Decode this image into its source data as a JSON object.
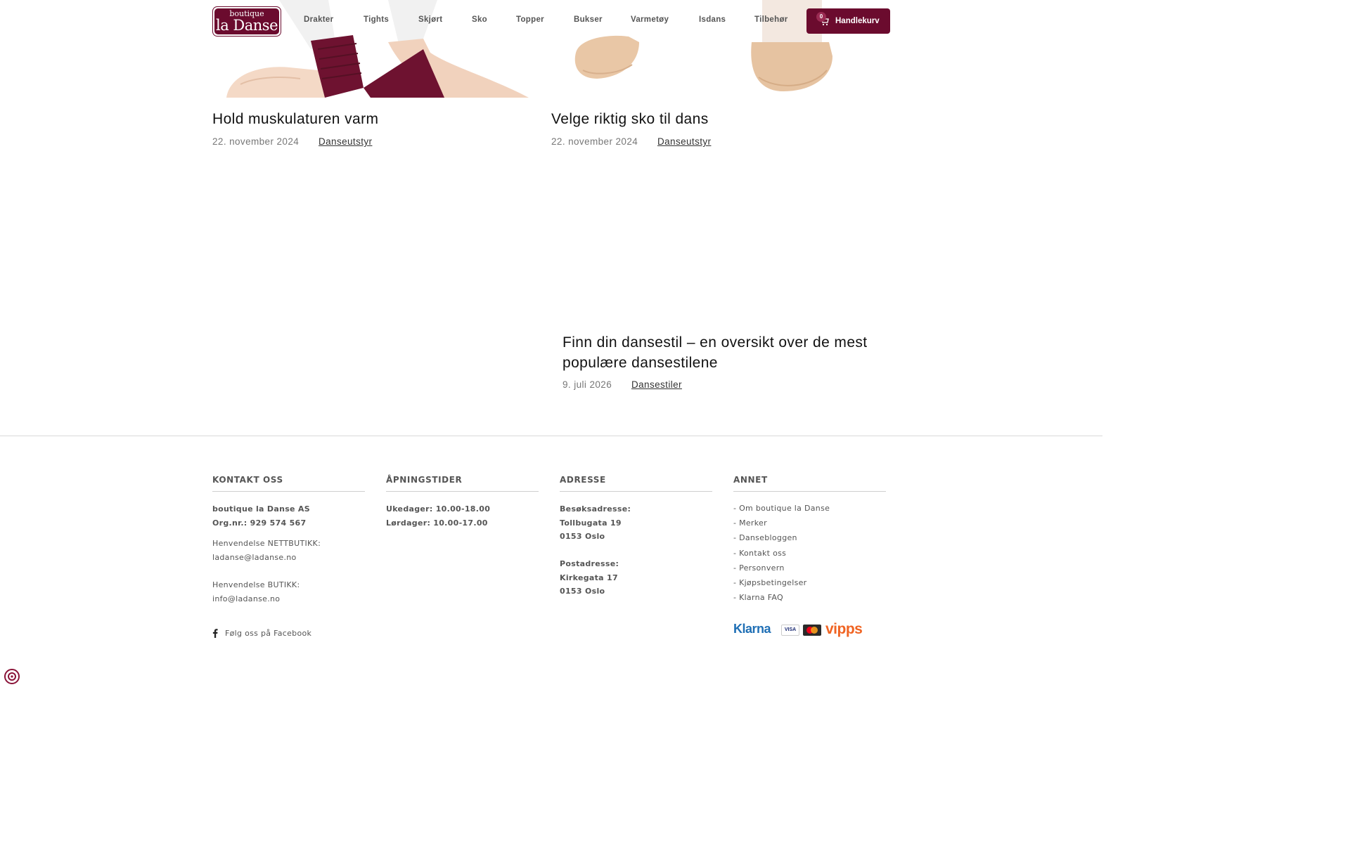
{
  "header": {
    "logo": {
      "small": "boutique",
      "big": "la Danse"
    },
    "nav": [
      "Drakter",
      "Tights",
      "Skjørt",
      "Sko",
      "Topper",
      "Bukser",
      "Varmetøy",
      "Isdans",
      "Tilbehør"
    ],
    "cart": {
      "label": "Handlekurv",
      "count": "0"
    }
  },
  "posts": [
    {
      "title": "Hold muskulaturen varm",
      "date": "22. november 2024",
      "category": "Danseutstyr"
    },
    {
      "title": "Velge riktig sko til dans",
      "date": "22. november 2024",
      "category": "Danseutstyr"
    },
    {
      "title_line1": "Finn din dansestil – en oversikt over de mest",
      "title_line2": "populære dansestilene",
      "date": "9. juli 2026",
      "category": "Dansestiler"
    }
  ],
  "footer": {
    "contact": {
      "heading": "KONTAKT OSS",
      "company": "boutique la Danse AS",
      "orgnr": "Org.nr.: 929 574 567",
      "web_label": "Henvendelse NETTBUTIKK:",
      "web_email": "ladanse@ladanse.no",
      "shop_label": "Henvendelse BUTIKK:",
      "shop_email": "info@ladanse.no",
      "facebook": "Følg oss på Facebook"
    },
    "hours": {
      "heading": "ÅPNINGSTIDER",
      "weekdays": "Ukedager: 10.00-18.00",
      "saturday": "Lørdager: 10.00-17.00"
    },
    "address": {
      "heading": "ADRESSE",
      "visit_label": "Besøksadresse:",
      "visit_street": "Tollbugata 19",
      "visit_city": "0153 Oslo",
      "post_label": "Postadresse:",
      "post_street": "Kirkegata 17",
      "post_city": "0153 Oslo"
    },
    "other": {
      "heading": "ANNET",
      "links": [
        "- Om boutique la Danse",
        "- Merker",
        "- Dansebloggen",
        "- Kontakt oss",
        "- Personvern",
        "- Kjøpsbetingelser",
        "- Klarna FAQ"
      ]
    },
    "payments": {
      "klarna": "Klarna",
      "visa": "VISA",
      "vipps": "vipps"
    }
  },
  "colors": {
    "brand": "#6b0b2e",
    "text": "#555555"
  },
  "icons": [
    "cart-icon",
    "facebook-icon",
    "cookie-settings-icon"
  ]
}
